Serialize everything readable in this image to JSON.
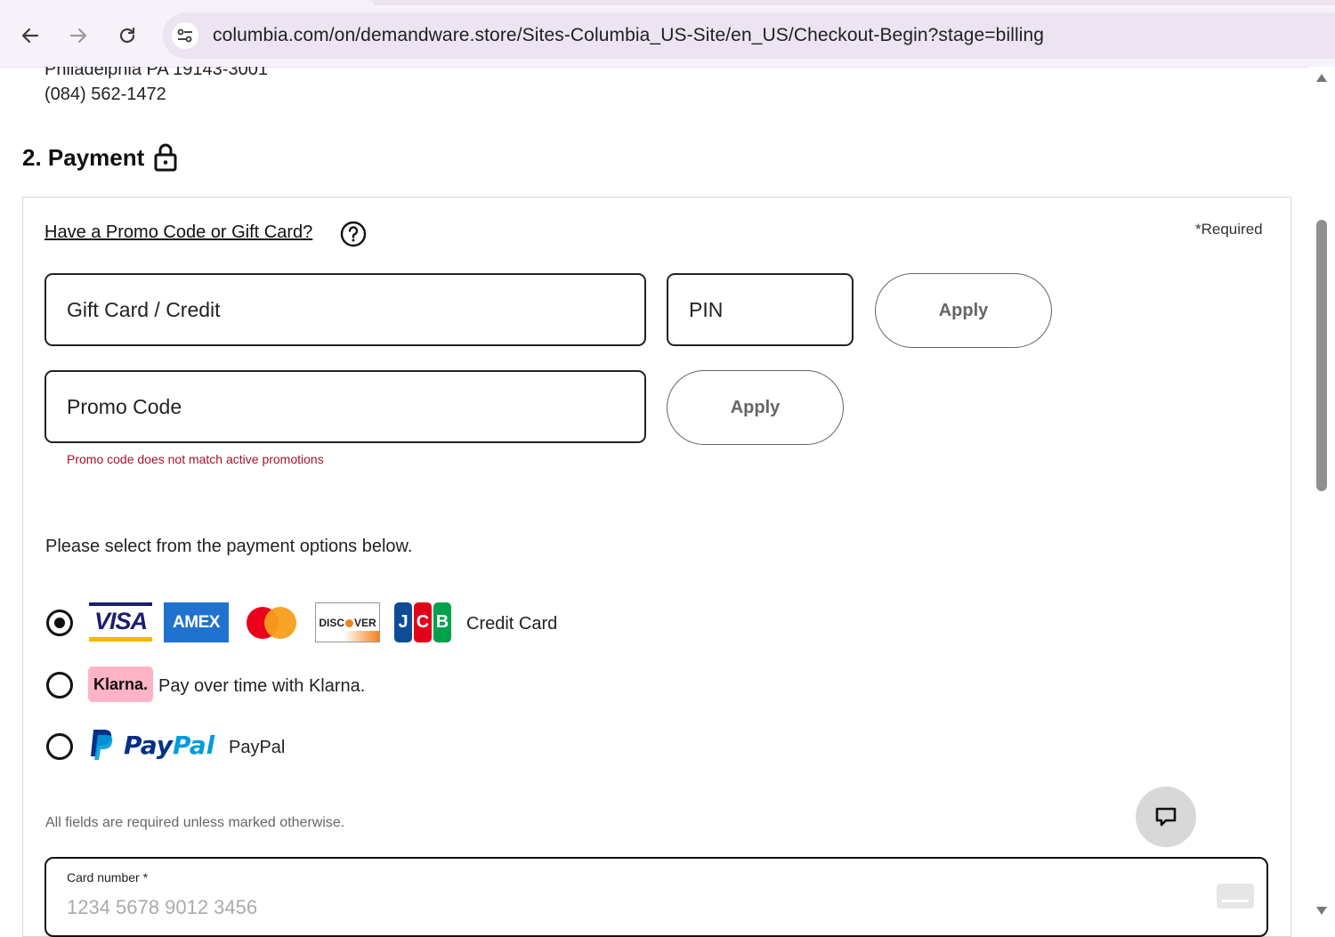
{
  "browser": {
    "url": "columbia.com/on/demandware.store/Sites-Columbia_US-Site/en_US/Checkout-Begin?stage=billing"
  },
  "shipping_address": {
    "city_line": "Philadelphia PA 19143-3001",
    "phone": "(084) 562-1472"
  },
  "payment": {
    "title": "2. Payment",
    "promo_link": "Have a Promo Code or Gift Card?",
    "required_note": "*Required",
    "gift_card_label": "Gift Card / Credit",
    "pin_label": "PIN",
    "apply_gift_label": "Apply",
    "promo_code_label": "Promo Code",
    "apply_promo_label": "Apply",
    "promo_error": "Promo code does not match active promotions",
    "instructions": "Please select from the payment options below.",
    "options": [
      {
        "label": "Credit Card",
        "selected": true
      },
      {
        "label": "Pay over time with Klarna.",
        "selected": false
      },
      {
        "label": "PayPal",
        "selected": false
      }
    ],
    "logos": {
      "visa": "VISA",
      "amex": "AMEX",
      "discover": "DISCOVER",
      "jcb": [
        "J",
        "C",
        "B"
      ],
      "klarna": "Klarna.",
      "paypal": "PayPal"
    },
    "fields_note": "All fields are required unless marked otherwise.",
    "card_number_label": "Card number *",
    "card_number_placeholder": "1234 5678 9012 3456"
  },
  "colors": {
    "error": "#a4122a",
    "visa_blue": "#1a1f71",
    "amex_blue": "#1f72cd",
    "klarna_pink": "#ffb3c7",
    "paypal_dark": "#003087",
    "paypal_light": "#009cde"
  }
}
